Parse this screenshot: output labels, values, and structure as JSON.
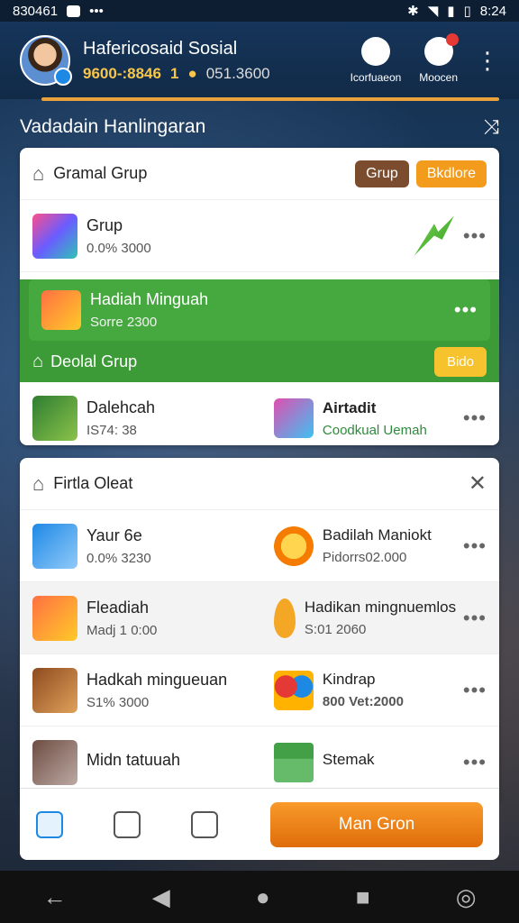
{
  "status_bar": {
    "left_text": "830461",
    "time": "8:24"
  },
  "header": {
    "name": "Hafericosaid Sosial",
    "stat1": "9600-:8846",
    "stat2": "1",
    "stat3": "051.3600",
    "btn1_label": "Icorfuaeon",
    "btn2_label": "Moocen"
  },
  "section1": {
    "title": "Vadadain Hanlingaran"
  },
  "card1": {
    "title": "Gramal Grup",
    "btn_brown": "Grup",
    "btn_orange": "Bkdlore",
    "row1": {
      "name": "Grup",
      "sub": "0.0% 3000"
    },
    "green": {
      "name": "Hadiah Minguah",
      "sub": "Sorre 2300",
      "sub_title": "Deolal Grup",
      "btn": "Bido"
    },
    "row2": {
      "name": "Dalehcah",
      "sub": "IS74: 38",
      "right_name": "Airtadit",
      "right_sub": "Coodkual Uemah"
    }
  },
  "card2": {
    "title": "Firtla Oleat",
    "rows": [
      {
        "name": "Yaur 6e",
        "sub": "0.0% 3230",
        "right_name": "Badilah Maniokt",
        "right_sub": "Pidorrs02.000"
      },
      {
        "name": "Fleadiah",
        "sub": "Madj 1 0:00",
        "right_name": "Hadikan mingnuemlos",
        "right_sub": "S:01 2060"
      },
      {
        "name": "Hadkah mingueuan",
        "sub": "S1% 3000",
        "right_name": "Kindrap",
        "right_sub": "800 Vet:2000"
      },
      {
        "name": "Midn tatuuah",
        "sub": "",
        "right_name": "Stemak",
        "right_sub": ""
      }
    ]
  },
  "bottom": {
    "main_button": "Man Gron"
  }
}
